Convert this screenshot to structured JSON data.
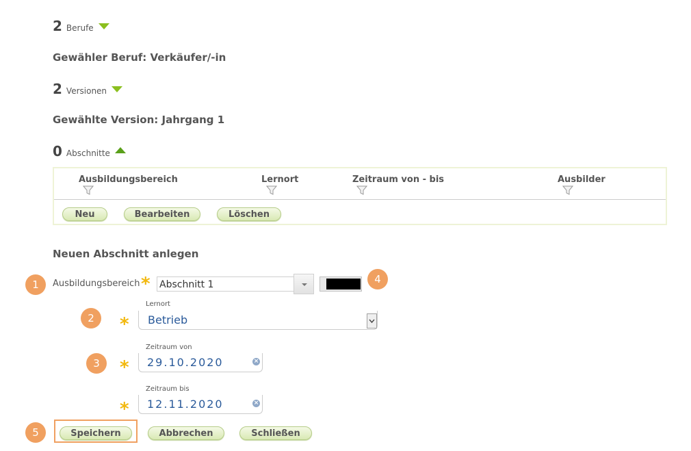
{
  "berufe": {
    "count": "2",
    "label": "Berufe"
  },
  "selected_beruf": "Gewähler Beruf: Verkäufer/-in",
  "versionen": {
    "count": "2",
    "label": "Versionen"
  },
  "selected_version": "Gewählte Version: Jahrgang 1",
  "abschnitte": {
    "count": "0",
    "label": "Abschnitte"
  },
  "table": {
    "columns": [
      "Ausbildungsbereich",
      "Lernort",
      "Zeitraum von - bis",
      "Ausbilder"
    ],
    "buttons": {
      "new": "Neu",
      "edit": "Bearbeiten",
      "delete": "Löschen"
    }
  },
  "form": {
    "title": "Neuen Abschnitt anlegen",
    "ausbildungsbereich": {
      "label": "Ausbildungsbereich",
      "value": "Abschnitt 1",
      "color": "#000000"
    },
    "lernort": {
      "label": "Lernort",
      "value": "Betrieb"
    },
    "zeitraum_von": {
      "label": "Zeitraum von",
      "value": "29.10.2020"
    },
    "zeitraum_bis": {
      "label": "Zeitraum bis",
      "value": "12.11.2020"
    },
    "required_marker": "*",
    "buttons": {
      "save": "Speichern",
      "cancel": "Abbrechen",
      "close": "Schließen"
    }
  },
  "annotations": [
    "1",
    "2",
    "3",
    "4",
    "5"
  ],
  "colors": {
    "badge": "#f0a060",
    "star": "#f2b80f",
    "arrow_down": "#8bbf1f",
    "arrow_up": "#5aa01a",
    "pill_border": "#b5cc88"
  }
}
